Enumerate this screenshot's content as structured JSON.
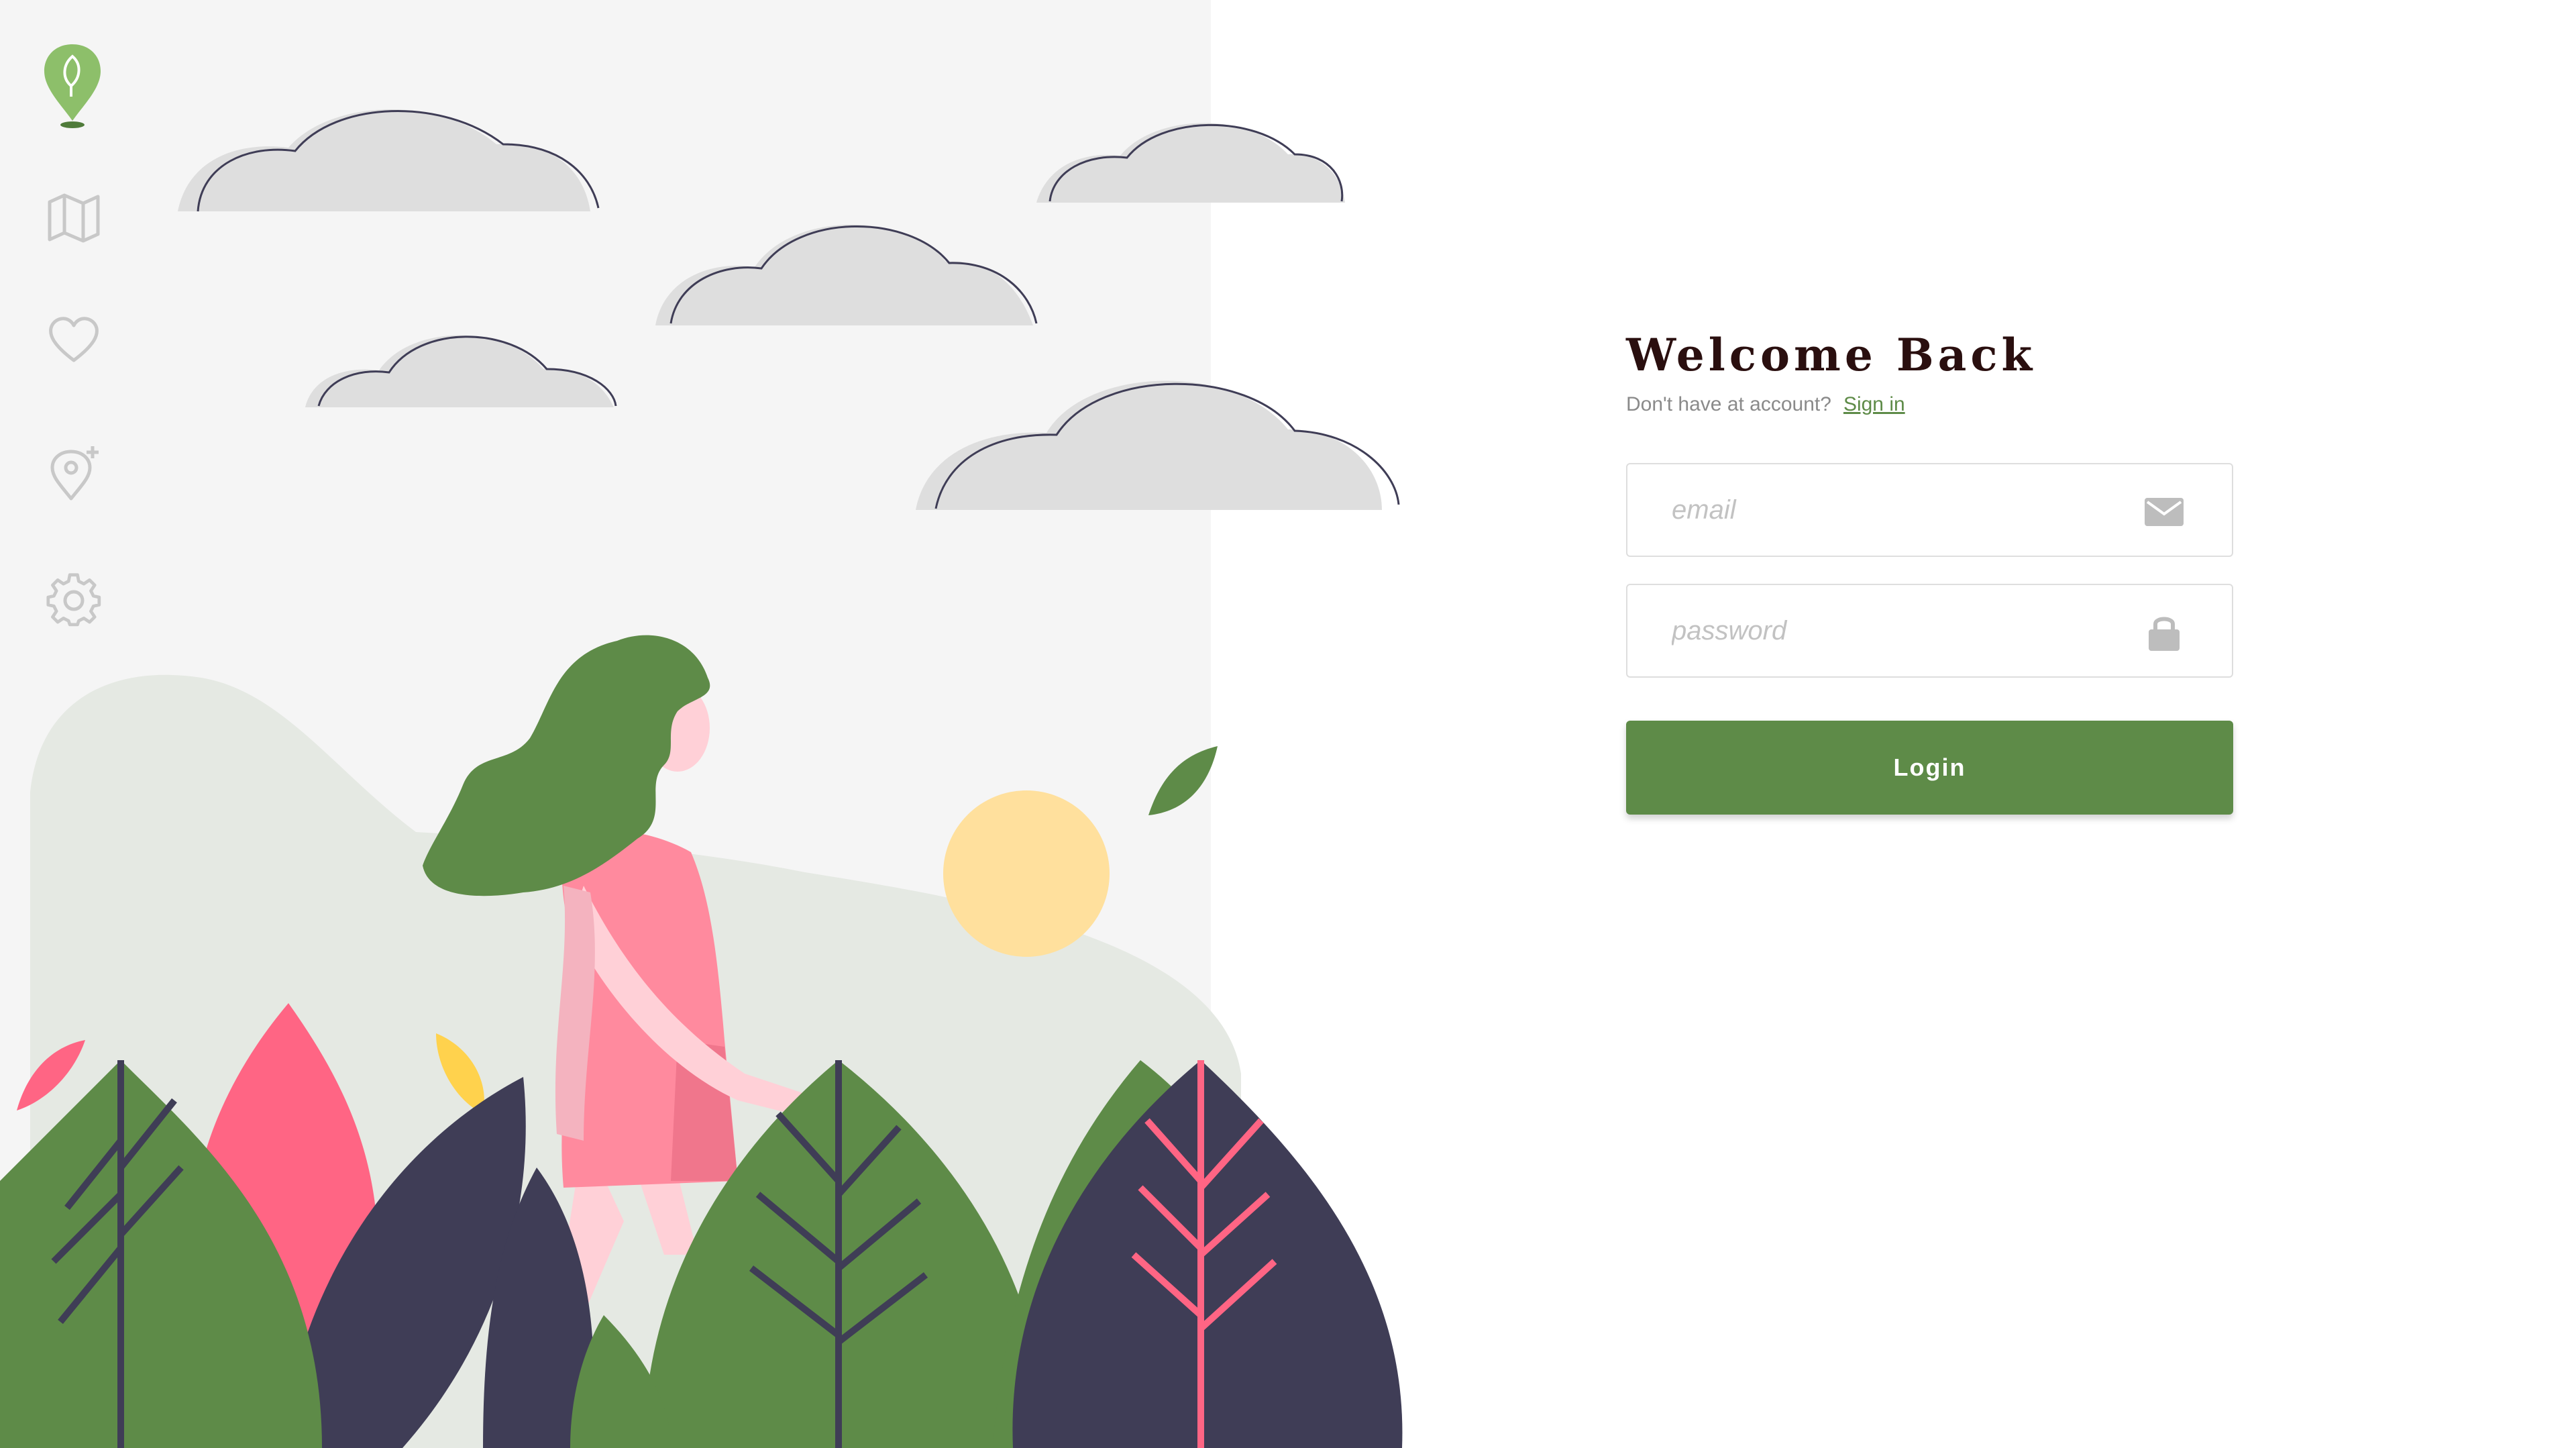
{
  "login": {
    "title": "Welcome Back",
    "no_account_text": "Don't have at account?",
    "sign_in_link": "Sign in",
    "email_placeholder": "email",
    "password_placeholder": "password",
    "login_button": "Login"
  },
  "sidebar": {
    "items": [
      {
        "icon": "map-icon"
      },
      {
        "icon": "heart-icon"
      },
      {
        "icon": "add-location-icon"
      },
      {
        "icon": "settings-icon"
      }
    ]
  },
  "colors": {
    "accent": "#5e8b48",
    "title": "#2a0f0f",
    "panel_bg": "#f5f5f5"
  }
}
